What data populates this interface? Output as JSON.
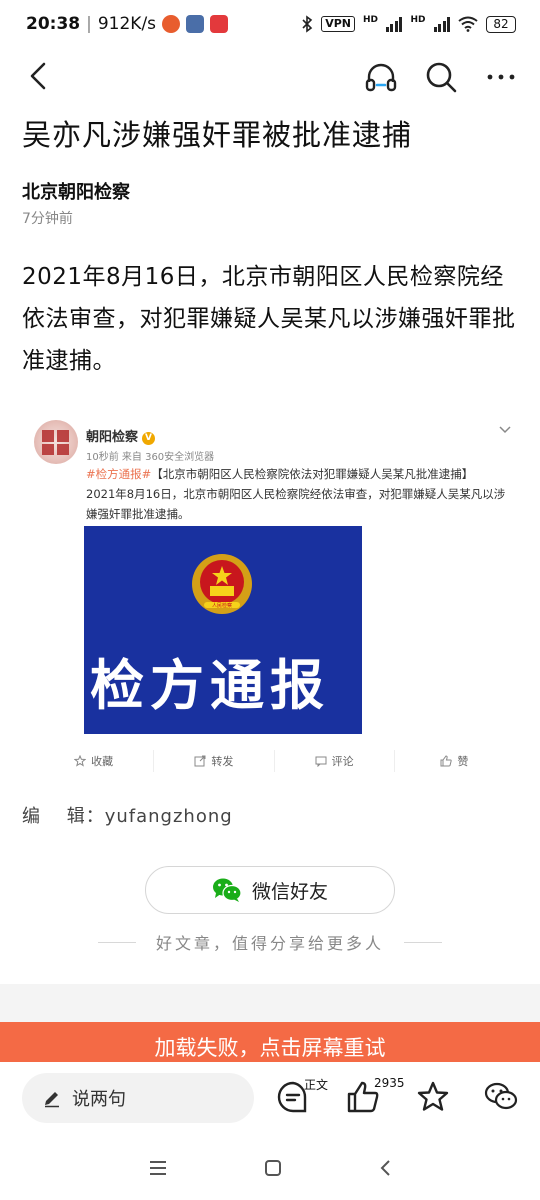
{
  "status_bar": {
    "time": "20:38",
    "speed": "912K/s",
    "vpn": "VPN",
    "hd1": "HD",
    "hd2": "HD",
    "battery": "82"
  },
  "nav": {
    "back_icon": "chevron-left-icon",
    "listen_icon": "headphones-icon",
    "search_icon": "search-icon",
    "more_icon": "more-icon"
  },
  "article": {
    "title": "吴亦凡涉嫌强奸罪被批准逮捕",
    "author": "北京朝阳检察",
    "time_ago": "7分钟前",
    "body": "2021年8月16日，北京市朝阳区人民检察院经依法审查，对犯罪嫌疑人吴某凡以涉嫌强奸罪批准逮捕。",
    "editor": "编　 辑：yufangzhong"
  },
  "embed": {
    "account_name": "朝阳检察",
    "verified": "V",
    "meta": "10秒前 来自 360安全浏览器",
    "tag": "#检方通报#",
    "headline": "【北京市朝阳区人民检察院依法对犯罪嫌疑人吴某凡批准逮捕】",
    "text": "2021年8月16日，北京市朝阳区人民检察院经依法审查，对犯罪嫌疑人吴某凡以涉嫌强奸罪批准逮捕。",
    "banner_text": "检方通报",
    "emblem_text": "人民检察",
    "actions": [
      "收藏",
      "转发",
      "评论",
      "赞"
    ]
  },
  "share": {
    "button_label": "微信好友",
    "hint": "好文章，值得分享给更多人"
  },
  "error_bar": {
    "text": "加载失败，点击屏幕重试"
  },
  "bottom_bar": {
    "comment_placeholder": "说两句",
    "body_badge": "正文",
    "like_count": "2935"
  },
  "colors": {
    "accent_orange": "#f46a45",
    "wechat_green": "#1aad19",
    "banner_blue": "#19319f",
    "tag_orange": "#eb7350"
  }
}
